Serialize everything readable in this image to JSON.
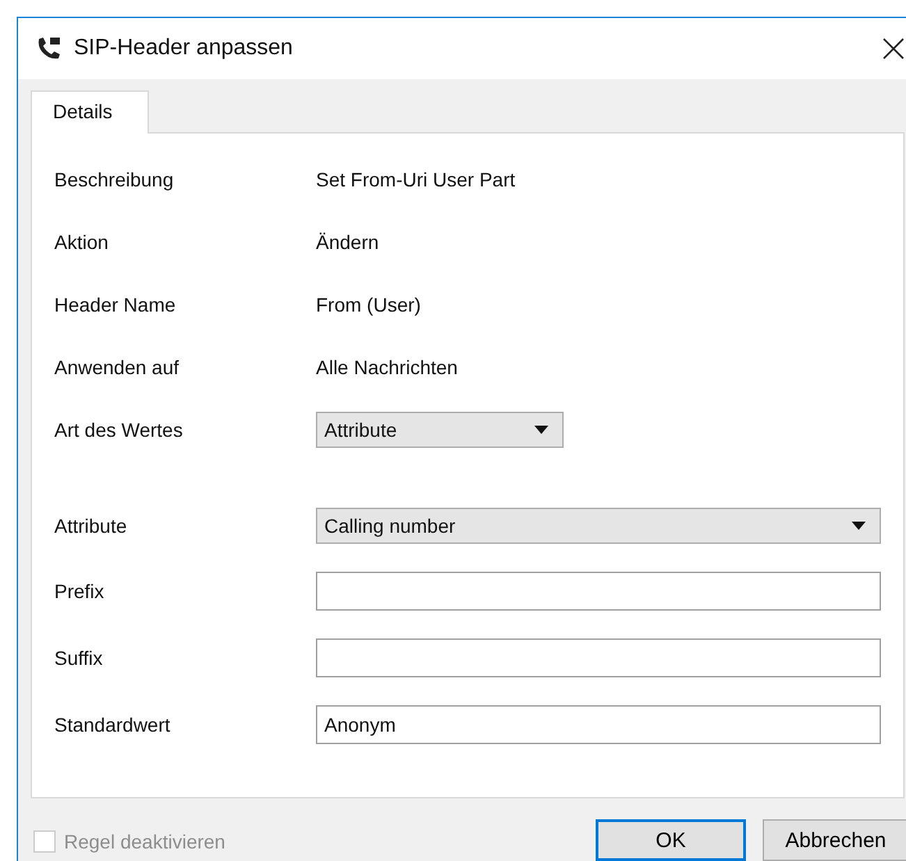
{
  "window": {
    "title": "SIP-Header anpassen"
  },
  "tabs": [
    {
      "label": "Details",
      "selected": true
    }
  ],
  "general": [
    {
      "kind": "text",
      "label": "Beschreibung",
      "value": "Set From-Uri User Part"
    },
    {
      "kind": "text",
      "label": "Aktion",
      "value": "Ändern"
    },
    {
      "kind": "text",
      "label": "Header Name",
      "value": "From (User)"
    },
    {
      "kind": "text",
      "label": "Anwenden auf",
      "value": "Alle Nachrichten"
    },
    {
      "kind": "dropdown",
      "label": "Art des Wertes",
      "value": "Attribute"
    }
  ],
  "value": [
    {
      "kind": "dropdown",
      "label": "Attribute",
      "value": "Calling number"
    },
    {
      "kind": "input",
      "label": "Prefix"
    },
    {
      "kind": "input",
      "label": "Suffix"
    },
    {
      "kind": "input",
      "label": "Standardwert",
      "value": "Anonym"
    }
  ],
  "disable_rule": {
    "label": "Regel deaktivieren",
    "checked": false,
    "disabled": true
  },
  "buttons": [
    {
      "label": "OK",
      "default": true
    },
    {
      "label": "Abbrechen",
      "default": false
    }
  ]
}
